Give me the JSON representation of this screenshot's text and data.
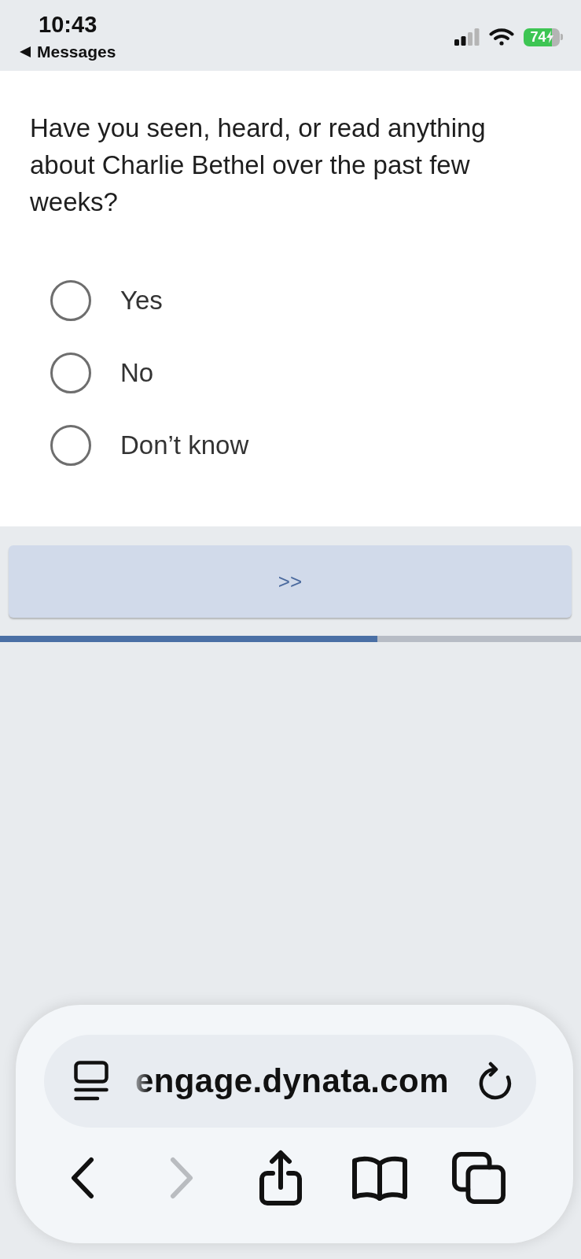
{
  "status_bar": {
    "time": "10:43",
    "back_link": "Messages",
    "battery": "74"
  },
  "question": {
    "text": "Have you seen, heard, or read anything about Charlie Bethel over the past few weeks?",
    "options": [
      {
        "label": "Yes",
        "selected": false
      },
      {
        "label": "No",
        "selected": false
      },
      {
        "label": "Don’t know",
        "selected": false
      }
    ]
  },
  "next_button": {
    "label": ">>"
  },
  "progress": {
    "level": 0.65
  },
  "browser": {
    "address_bar": {
      "url": "engage.dynata.com"
    },
    "toolbar": [
      {
        "kind": "back",
        "disabled": false
      },
      {
        "kind": "forward",
        "disabled": true
      },
      {
        "kind": "share",
        "disabled": false
      },
      {
        "kind": "bookmarks",
        "disabled": false
      },
      {
        "kind": "tabs",
        "disabled": false
      }
    ]
  }
}
